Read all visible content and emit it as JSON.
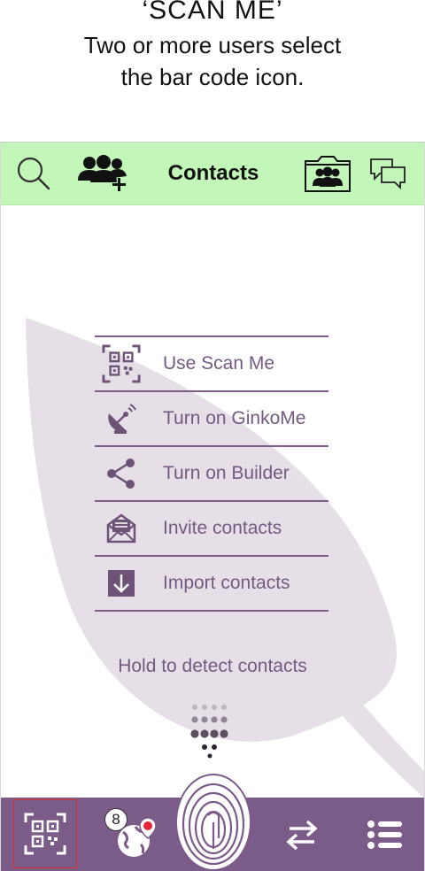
{
  "caption": {
    "title": "‘SCAN ME’",
    "line1": "Two or more users select",
    "line2": "the bar code icon."
  },
  "topbar": {
    "title": "Contacts",
    "icons": [
      "search-icon",
      "add-contacts-icon",
      "contacts-folder-icon",
      "chat-icon"
    ],
    "background": "#c3f6b9"
  },
  "menu": {
    "items": [
      {
        "label": "Use Scan Me",
        "icon": "qr-code-icon"
      },
      {
        "label": "Turn on GinkoMe",
        "icon": "satellite-dish-icon"
      },
      {
        "label": "Turn on Builder",
        "icon": "share-icon"
      },
      {
        "label": "Invite contacts",
        "icon": "envelope-icon"
      },
      {
        "label": "Import contacts",
        "icon": "import-icon"
      }
    ],
    "color": "#735b80"
  },
  "detect": {
    "label": "Hold to detect contacts"
  },
  "bottombar": {
    "background": "#7b5b87",
    "badge_count": "8",
    "icons": [
      "qr-scan-icon",
      "globe-location-icon",
      "fingerprint-icon",
      "swap-arrows-icon",
      "list-menu-icon"
    ]
  }
}
